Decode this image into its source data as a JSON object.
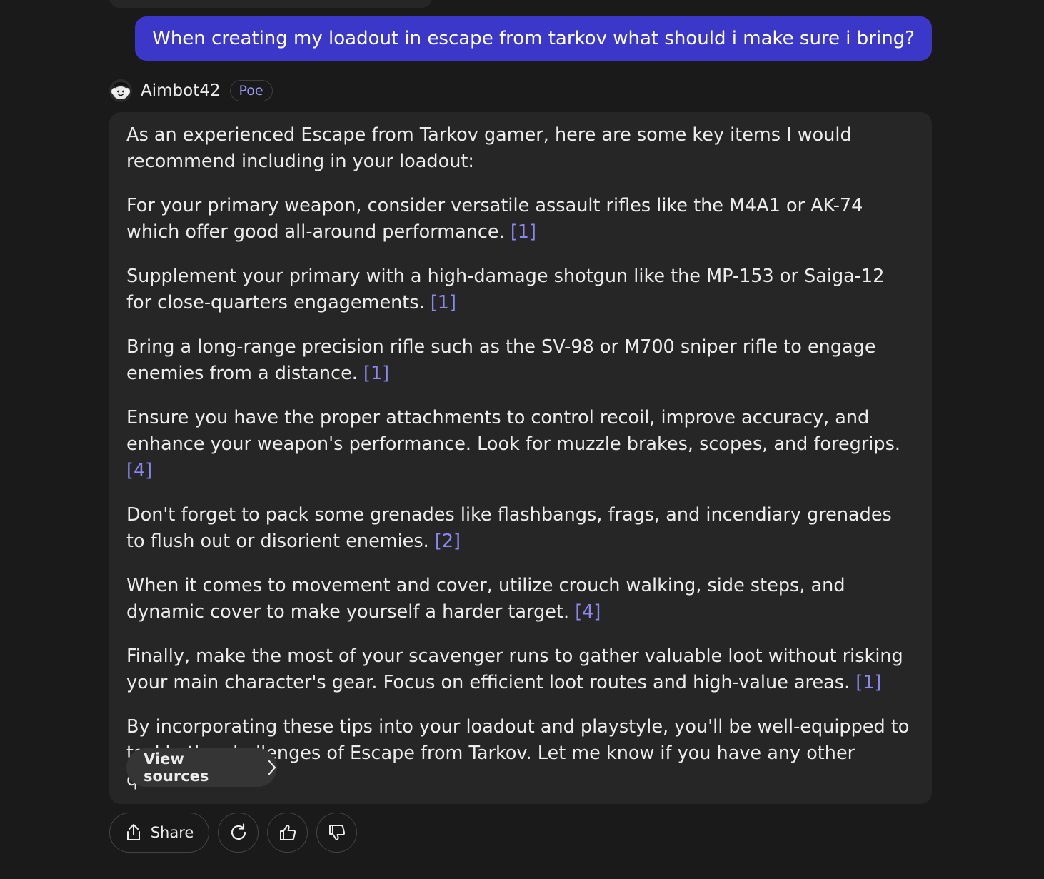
{
  "user_message": {
    "text": "When creating my loadout in escape from tarkov what should i make sure i bring?"
  },
  "bot": {
    "name": "Aimbot42",
    "badge": "Poe"
  },
  "response": {
    "paragraphs": [
      {
        "text": "As an experienced Escape from Tarkov gamer, here are some key items I would recommend including in your loadout:",
        "cite": ""
      },
      {
        "text": "For your primary weapon, consider versatile assault rifles like the M4A1 or AK-74 which offer good all-around performance.",
        "cite": "[1]"
      },
      {
        "text": "Supplement your primary with a high-damage shotgun like the MP-153 or Saiga-12 for close-quarters engagements.",
        "cite": "[1]"
      },
      {
        "text": "Bring a long-range precision rifle such as the SV-98 or M700 sniper rifle to engage enemies from a distance.",
        "cite": "[1]"
      },
      {
        "text": "Ensure you have the proper attachments to control recoil, improve accuracy, and enhance your weapon's performance. Look for muzzle brakes, scopes, and foregrips.",
        "cite": "[4]"
      },
      {
        "text": "Don't forget to pack some grenades like flashbangs, frags, and incendiary grenades to flush out or disorient enemies.",
        "cite": "[2]"
      },
      {
        "text": "When it comes to movement and cover, utilize crouch walking, side steps, and dynamic cover to make yourself a harder target.",
        "cite": "[4]"
      },
      {
        "text": "Finally, make the most of your scavenger runs to gather valuable loot without risking your main character's gear. Focus on efficient loot routes and high-value areas.",
        "cite": "[1]"
      },
      {
        "text": "By incorporating these tips into your loadout and playstyle, you'll be well-equipped to tackle the challenges of Escape from Tarkov. Let me know if you have any other questions!",
        "cite": ""
      }
    ],
    "view_sources_label": "View sources"
  },
  "actions": {
    "share_label": "Share"
  },
  "colors": {
    "background": "#1a1a1a",
    "user_bubble": "#3b37c9",
    "bot_bubble": "#262626",
    "accent": "#8a87ee"
  },
  "icons": {
    "avatar": "robot-face-icon",
    "view_sources": "chevron-right-icon",
    "share": "share-icon",
    "retry": "retry-icon",
    "like": "thumbs-up-icon",
    "dislike": "thumbs-down-icon"
  }
}
